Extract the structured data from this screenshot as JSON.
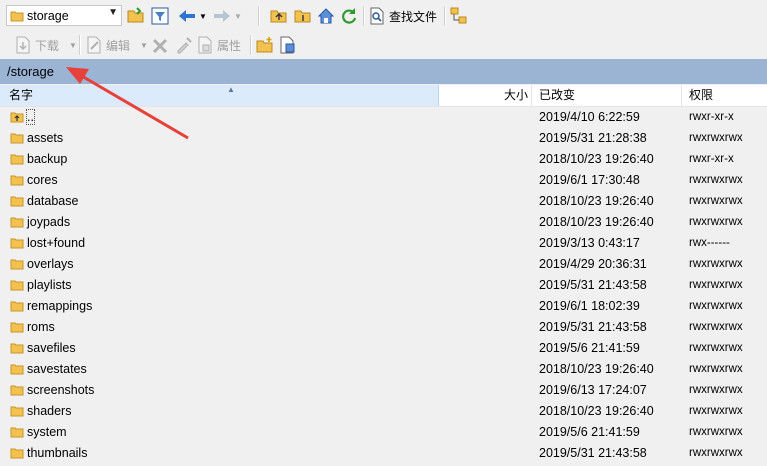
{
  "toolbar_top": {
    "location_combo": "storage",
    "find_files_label": "查找文件"
  },
  "toolbar_bottom": {
    "download_label": "下载",
    "edit_label": "编辑",
    "properties_label": "属性"
  },
  "path": "/storage",
  "columns": {
    "name": "名字",
    "size": "大小",
    "modified": "已改变",
    "permissions": "权限"
  },
  "files": [
    {
      "name": "..",
      "size": "",
      "modified": "2019/4/10 6:22:59",
      "permissions": "rwxr-xr-x",
      "icon": "parent-dir-icon"
    },
    {
      "name": "assets",
      "size": "",
      "modified": "2019/5/31 21:28:38",
      "permissions": "rwxrwxrwx",
      "icon": "folder-icon"
    },
    {
      "name": "backup",
      "size": "",
      "modified": "2018/10/23 19:26:40",
      "permissions": "rwxr-xr-x",
      "icon": "folder-icon"
    },
    {
      "name": "cores",
      "size": "",
      "modified": "2019/6/1 17:30:48",
      "permissions": "rwxrwxrwx",
      "icon": "folder-icon"
    },
    {
      "name": "database",
      "size": "",
      "modified": "2018/10/23 19:26:40",
      "permissions": "rwxrwxrwx",
      "icon": "folder-icon"
    },
    {
      "name": "joypads",
      "size": "",
      "modified": "2018/10/23 19:26:40",
      "permissions": "rwxrwxrwx",
      "icon": "folder-icon"
    },
    {
      "name": "lost+found",
      "size": "",
      "modified": "2019/3/13 0:43:17",
      "permissions": "rwx------",
      "icon": "folder-icon"
    },
    {
      "name": "overlays",
      "size": "",
      "modified": "2019/4/29 20:36:31",
      "permissions": "rwxrwxrwx",
      "icon": "folder-icon"
    },
    {
      "name": "playlists",
      "size": "",
      "modified": "2019/5/31 21:43:58",
      "permissions": "rwxrwxrwx",
      "icon": "folder-icon"
    },
    {
      "name": "remappings",
      "size": "",
      "modified": "2019/6/1 18:02:39",
      "permissions": "rwxrwxrwx",
      "icon": "folder-icon"
    },
    {
      "name": "roms",
      "size": "",
      "modified": "2019/5/31 21:43:58",
      "permissions": "rwxrwxrwx",
      "icon": "folder-icon"
    },
    {
      "name": "savefiles",
      "size": "",
      "modified": "2019/5/6 21:41:59",
      "permissions": "rwxrwxrwx",
      "icon": "folder-icon"
    },
    {
      "name": "savestates",
      "size": "",
      "modified": "2018/10/23 19:26:40",
      "permissions": "rwxrwxrwx",
      "icon": "folder-icon"
    },
    {
      "name": "screenshots",
      "size": "",
      "modified": "2019/6/13 17:24:07",
      "permissions": "rwxrwxrwx",
      "icon": "folder-icon"
    },
    {
      "name": "shaders",
      "size": "",
      "modified": "2018/10/23 19:26:40",
      "permissions": "rwxrwxrwx",
      "icon": "folder-icon"
    },
    {
      "name": "system",
      "size": "",
      "modified": "2019/5/6 21:41:59",
      "permissions": "rwxrwxrwx",
      "icon": "folder-icon"
    },
    {
      "name": "thumbnails",
      "size": "",
      "modified": "2019/5/31 21:43:58",
      "permissions": "rwxrwxrwx",
      "icon": "folder-icon"
    }
  ],
  "colors": {
    "path_bar": "#9bb4d4",
    "annotation_arrow": "#e8403a",
    "folder": "#f2c14e"
  }
}
